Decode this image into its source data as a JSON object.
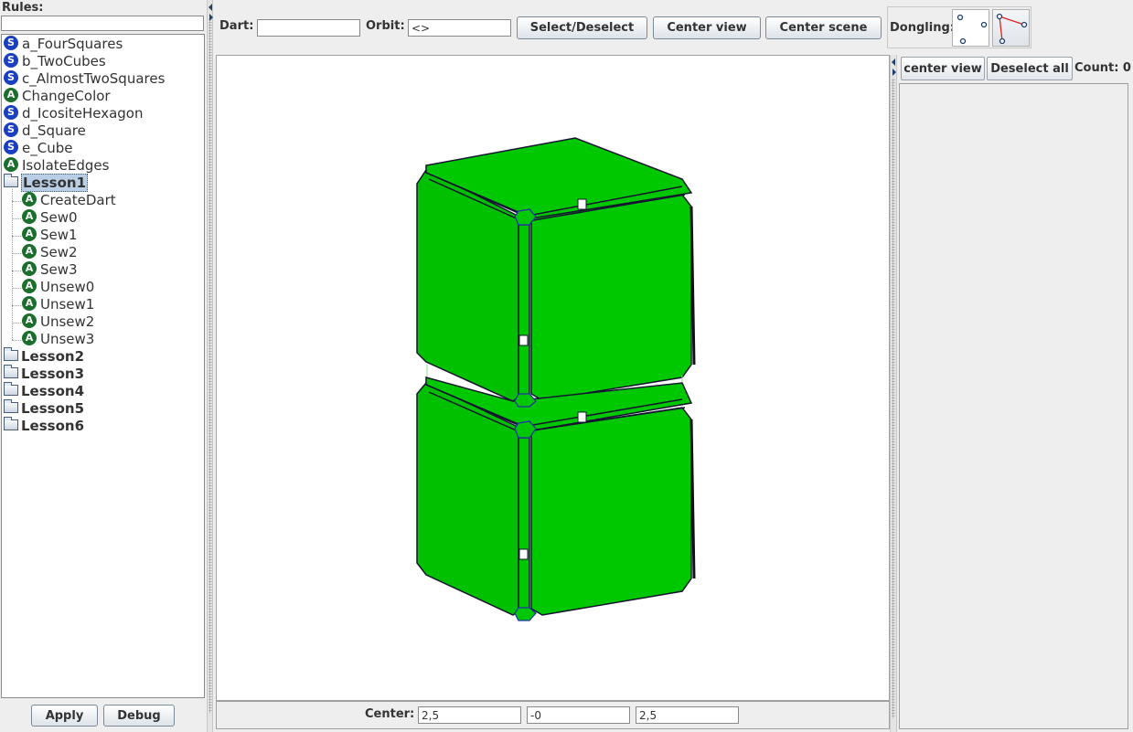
{
  "rules_panel": {
    "label": "Rules:",
    "filter_value": "",
    "tree": [
      {
        "kind": "rule",
        "icon": "S",
        "label": "a_FourSquares"
      },
      {
        "kind": "rule",
        "icon": "S",
        "label": "b_TwoCubes"
      },
      {
        "kind": "rule",
        "icon": "S",
        "label": "c_AlmostTwoSquares"
      },
      {
        "kind": "rule",
        "icon": "A",
        "label": "ChangeColor"
      },
      {
        "kind": "rule",
        "icon": "S",
        "label": "d_IcositeHexagon"
      },
      {
        "kind": "rule",
        "icon": "S",
        "label": "d_Square"
      },
      {
        "kind": "rule",
        "icon": "S",
        "label": "e_Cube"
      },
      {
        "kind": "rule",
        "icon": "A",
        "label": "IsolateEdges"
      },
      {
        "kind": "folder",
        "label": "Lesson1",
        "selected": true,
        "expanded": true,
        "children": [
          {
            "icon": "A",
            "label": "CreateDart"
          },
          {
            "icon": "A",
            "label": "Sew0"
          },
          {
            "icon": "A",
            "label": "Sew1"
          },
          {
            "icon": "A",
            "label": "Sew2"
          },
          {
            "icon": "A",
            "label": "Sew3"
          },
          {
            "icon": "A",
            "label": "Unsew0"
          },
          {
            "icon": "A",
            "label": "Unsew1"
          },
          {
            "icon": "A",
            "label": "Unsew2"
          },
          {
            "icon": "A",
            "label": "Unsew3"
          }
        ]
      },
      {
        "kind": "folder",
        "label": "Lesson2"
      },
      {
        "kind": "folder",
        "label": "Lesson3"
      },
      {
        "kind": "folder",
        "label": "Lesson4"
      },
      {
        "kind": "folder",
        "label": "Lesson5"
      },
      {
        "kind": "folder",
        "label": "Lesson6"
      }
    ],
    "apply_label": "Apply",
    "debug_label": "Debug"
  },
  "toolbar": {
    "dart_label": "Dart:",
    "dart_value": "",
    "orbit_label": "Orbit:",
    "orbit_value": "<>",
    "select_deselect_label": "Select/Deselect",
    "center_view_label": "Center view",
    "center_scene_label": "Center scene",
    "dongling_label": "Dongling:"
  },
  "viewport": {
    "fill_color": "#00c800",
    "edge_color": "#1a1a3a"
  },
  "center_bar": {
    "label": "Center:",
    "x": "2,5",
    "y": "-0",
    "z": "2,5"
  },
  "right_panel": {
    "center_view_label": "center view",
    "deselect_all_label": "Deselect all",
    "count_label": "Count: 0"
  },
  "colors": {
    "rule_s": "#1b3fc2",
    "rule_a": "#1b6e2b",
    "model_green": "#00c800"
  }
}
